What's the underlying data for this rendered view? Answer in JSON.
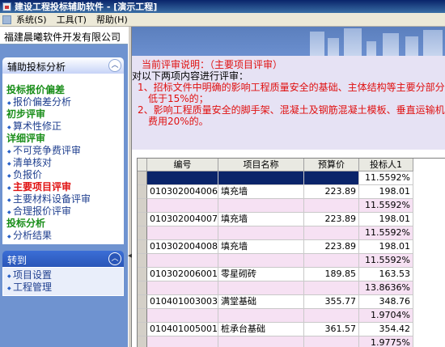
{
  "title": "建设工程投标辅助软件 - [演示工程]",
  "menu": [
    "系统(S)",
    "工具(T)",
    "帮助(H)"
  ],
  "company": "福建晨曦软件开发有限公司",
  "panel1": {
    "title": "辅助投标分析",
    "groups": [
      {
        "label": "投标报价偏差",
        "items": [
          "报价偏差分析"
        ]
      },
      {
        "label": "初步评审",
        "items": [
          "算术性修正"
        ]
      },
      {
        "label": "详细评审",
        "items": [
          "不可竞争费评审",
          "清单核对",
          "负报价",
          "主要项目评审",
          "主要材料设备评审",
          "合理报价评审"
        ]
      },
      {
        "label": "投标分析",
        "items": [
          "分析结果"
        ]
      }
    ],
    "active_item": "主要项目评审"
  },
  "panel2": {
    "title": "转到",
    "items": [
      "项目设置",
      "工程管理"
    ]
  },
  "desc": {
    "title": "当前评审说明：（主要项目评审）",
    "intro": "对以下两项内容进行评审：",
    "line1a": "1、招标文件中明确的影响工程质量安全的基础、主体结构等主要分部分项",
    "line1b": "低于15%的；",
    "line2a": "2、影响工程质量安全的脚手架、混凝土及钢筋混凝土模板、垂直运输机械",
    "line2b": "费用20%的。"
  },
  "grid": {
    "headers": [
      "编号",
      "项目名称",
      "预算价",
      "投标人1"
    ],
    "rows": [
      {
        "code": "",
        "name": "",
        "price": "",
        "bid": "11.5592%",
        "selected": true
      },
      {
        "code": "010302004006",
        "name": "填充墙",
        "price": "223.89",
        "bid": "198.01"
      },
      {
        "code": "",
        "name": "",
        "price": "",
        "bid": "11.5592%"
      },
      {
        "code": "010302004007",
        "name": "填充墙",
        "price": "223.89",
        "bid": "198.01"
      },
      {
        "code": "",
        "name": "",
        "price": "",
        "bid": "11.5592%"
      },
      {
        "code": "010302004008",
        "name": "填充墙",
        "price": "223.89",
        "bid": "198.01"
      },
      {
        "code": "",
        "name": "",
        "price": "",
        "bid": "11.5592%"
      },
      {
        "code": "010302006001",
        "name": "零星砌砖",
        "price": "189.85",
        "bid": "163.53"
      },
      {
        "code": "",
        "name": "",
        "price": "",
        "bid": "13.8636%"
      },
      {
        "code": "010401003003",
        "name": "满堂基础",
        "price": "355.77",
        "bid": "348.76"
      },
      {
        "code": "",
        "name": "",
        "price": "",
        "bid": "1.9704%"
      },
      {
        "code": "010401005001",
        "name": "桩承台基础",
        "price": "361.57",
        "bid": "354.42"
      },
      {
        "code": "",
        "name": "",
        "price": "",
        "bid": "1.9775%"
      },
      {
        "code": "010402001008",
        "name": "矩形柱",
        "price": "381.69",
        "bid": "371.94"
      }
    ]
  }
}
